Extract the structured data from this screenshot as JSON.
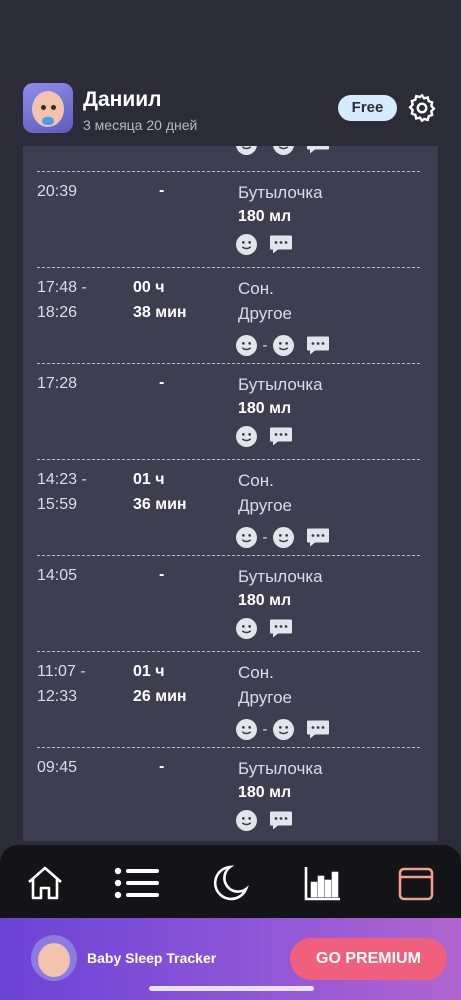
{
  "header": {
    "child_name": "Даниил",
    "child_age": "3 месяца 20 дней",
    "plan_badge": "Free"
  },
  "entries": [
    {
      "time_start": "20:39",
      "time_end": "",
      "duration_hours": "-",
      "duration_minutes": "",
      "type": "Бутылочка",
      "detail": "180 мл",
      "kind": "feeding"
    },
    {
      "time_start": "17:48 -",
      "time_end": "18:26",
      "duration_hours": "00 ч",
      "duration_minutes": "38 мин",
      "type": "Сон.",
      "detail": "Другое",
      "kind": "sleep"
    },
    {
      "time_start": "17:28",
      "time_end": "",
      "duration_hours": "-",
      "duration_minutes": "",
      "type": "Бутылочка",
      "detail": "180 мл",
      "kind": "feeding"
    },
    {
      "time_start": "14:23 -",
      "time_end": "15:59",
      "duration_hours": "01 ч",
      "duration_minutes": "36 мин",
      "type": "Сон.",
      "detail": "Другое",
      "kind": "sleep"
    },
    {
      "time_start": "14:05",
      "time_end": "",
      "duration_hours": "-",
      "duration_minutes": "",
      "type": "Бутылочка",
      "detail": "180 мл",
      "kind": "feeding"
    },
    {
      "time_start": "11:07 -",
      "time_end": "12:33",
      "duration_hours": "01 ч",
      "duration_minutes": "26 мин",
      "type": "Сон.",
      "detail": "Другое",
      "kind": "sleep"
    },
    {
      "time_start": "09:45",
      "time_end": "",
      "duration_hours": "-",
      "duration_minutes": "",
      "type": "Бутылочка",
      "detail": "180 мл",
      "kind": "feeding"
    }
  ],
  "icon_separator": "-",
  "bottom_nav": [
    {
      "icon": "home-icon",
      "active": false
    },
    {
      "icon": "list-icon",
      "active": false
    },
    {
      "icon": "moon-icon",
      "active": false
    },
    {
      "icon": "bar-chart-icon",
      "active": false
    },
    {
      "icon": "calendar-icon",
      "active": true
    }
  ],
  "promo": {
    "app_name": "Baby Sleep Tracker",
    "button_label": "GO PREMIUM"
  },
  "colors": {
    "background": "#2c2c38",
    "card": "#3d3f50",
    "badge": "#d4ecfb",
    "premium_button": "#f0607c",
    "active_nav": "#f0a08a"
  }
}
